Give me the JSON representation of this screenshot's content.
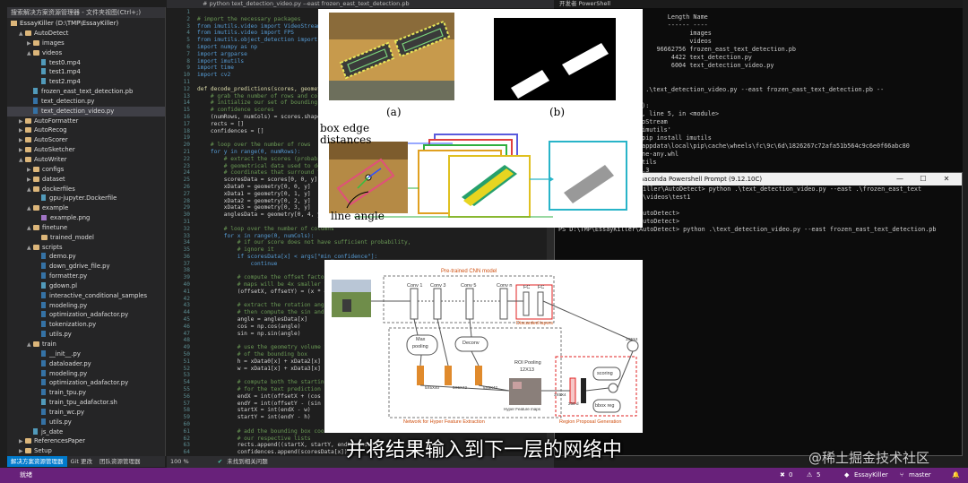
{
  "solution_explorer": {
    "search_placeholder": "搜索解决方案资源管理器 - 文件夹视图(Ctrl+;)",
    "root": "EssayKiller (D:\\TMP\\EssayKiller)",
    "items": [
      {
        "label": "AutoDetect",
        "kind": "folder",
        "arrow": "▲",
        "indent": 1
      },
      {
        "label": "images",
        "kind": "folder",
        "arrow": "▶",
        "indent": 2
      },
      {
        "label": "videos",
        "kind": "folder",
        "arrow": "▲",
        "indent": 2
      },
      {
        "label": "test0.mp4",
        "kind": "file",
        "arrow": "",
        "indent": 3
      },
      {
        "label": "test1.mp4",
        "kind": "file",
        "arrow": "",
        "indent": 3
      },
      {
        "label": "test2.mp4",
        "kind": "file",
        "arrow": "",
        "indent": 3
      },
      {
        "label": "frozen_east_text_detection.pb",
        "kind": "file",
        "arrow": "",
        "indent": 2
      },
      {
        "label": "text_detection.py",
        "kind": "py",
        "arrow": "",
        "indent": 2
      },
      {
        "label": "text_detection_video.py",
        "kind": "py",
        "arrow": "",
        "indent": 2,
        "selected": true
      },
      {
        "label": "AutoFormatter",
        "kind": "folder",
        "arrow": "▶",
        "indent": 1
      },
      {
        "label": "AutoRecog",
        "kind": "folder",
        "arrow": "▶",
        "indent": 1
      },
      {
        "label": "AutoScorer",
        "kind": "folder",
        "arrow": "▶",
        "indent": 1
      },
      {
        "label": "AutoSketcher",
        "kind": "folder",
        "arrow": "▶",
        "indent": 1
      },
      {
        "label": "AutoWriter",
        "kind": "folder",
        "arrow": "▲",
        "indent": 1
      },
      {
        "label": "configs",
        "kind": "folder",
        "arrow": "▶",
        "indent": 2
      },
      {
        "label": "dataset",
        "kind": "folder",
        "arrow": "▶",
        "indent": 2
      },
      {
        "label": "dockerfiles",
        "kind": "folder",
        "arrow": "▲",
        "indent": 2
      },
      {
        "label": "gpu-jupyter.Dockerfile",
        "kind": "file",
        "arrow": "",
        "indent": 3
      },
      {
        "label": "example",
        "kind": "folder",
        "arrow": "▲",
        "indent": 2
      },
      {
        "label": "example.png",
        "kind": "img",
        "arrow": "",
        "indent": 3
      },
      {
        "label": "finetune",
        "kind": "folder",
        "arrow": "▲",
        "indent": 2
      },
      {
        "label": "trained_model",
        "kind": "folder",
        "arrow": "",
        "indent": 3
      },
      {
        "label": "scripts",
        "kind": "folder",
        "arrow": "▲",
        "indent": 2
      },
      {
        "label": "demo.py",
        "kind": "py",
        "arrow": "",
        "indent": 3
      },
      {
        "label": "down_gdrive_file.py",
        "kind": "py",
        "arrow": "",
        "indent": 3
      },
      {
        "label": "formatter.py",
        "kind": "py",
        "arrow": "",
        "indent": 3
      },
      {
        "label": "gdown.pl",
        "kind": "file",
        "arrow": "",
        "indent": 3
      },
      {
        "label": "interactive_conditional_samples",
        "kind": "py",
        "arrow": "",
        "indent": 3
      },
      {
        "label": "modeling.py",
        "kind": "py",
        "arrow": "",
        "indent": 3
      },
      {
        "label": "optimization_adafactor.py",
        "kind": "py",
        "arrow": "",
        "indent": 3
      },
      {
        "label": "tokenization.py",
        "kind": "py",
        "arrow": "",
        "indent": 3
      },
      {
        "label": "utils.py",
        "kind": "py",
        "arrow": "",
        "indent": 3
      },
      {
        "label": "train",
        "kind": "folder",
        "arrow": "▲",
        "indent": 2
      },
      {
        "label": "__init__.py",
        "kind": "py",
        "arrow": "",
        "indent": 3
      },
      {
        "label": "dataloader.py",
        "kind": "py",
        "arrow": "",
        "indent": 3
      },
      {
        "label": "modeling.py",
        "kind": "py",
        "arrow": "",
        "indent": 3
      },
      {
        "label": "optimization_adafactor.py",
        "kind": "py",
        "arrow": "",
        "indent": 3
      },
      {
        "label": "train_tpu.py",
        "kind": "py",
        "arrow": "",
        "indent": 3
      },
      {
        "label": "train_tpu_adafactor.sh",
        "kind": "file",
        "arrow": "",
        "indent": 3
      },
      {
        "label": "train_wc.py",
        "kind": "py",
        "arrow": "",
        "indent": 3
      },
      {
        "label": "utils.py",
        "kind": "py",
        "arrow": "",
        "indent": 3
      },
      {
        "label": "js_date",
        "kind": "file",
        "arrow": "",
        "indent": 2
      },
      {
        "label": "ReferencesPaper",
        "kind": "folder",
        "arrow": "▶",
        "indent": 1
      },
      {
        "label": "Setup",
        "kind": "folder",
        "arrow": "▶",
        "indent": 1
      }
    ],
    "tabs": [
      {
        "label": "解决方案资源管理器",
        "active": true
      },
      {
        "label": "Git 更改",
        "active": false
      },
      {
        "label": "团队资源管理器",
        "active": false
      }
    ]
  },
  "editor": {
    "tab_title": "# python text_detection_video.py --east frozen_east_text_detection.pb",
    "zoom": "100 %",
    "issues": "未找到相关问题",
    "lines": [
      {
        "n": "",
        "t": "",
        "c": "code"
      },
      {
        "n": "",
        "t": "# import the necessary packages",
        "c": "comment"
      },
      {
        "n": "",
        "t": "from imutils.video import VideoStream",
        "c": "kw"
      },
      {
        "n": "",
        "t": "from imutils.video import FPS",
        "c": "kw"
      },
      {
        "n": "",
        "t": "from imutils.object_detection import non_max_suppression",
        "c": "kw"
      },
      {
        "n": "",
        "t": "import numpy as np",
        "c": "kw"
      },
      {
        "n": "",
        "t": "import argparse",
        "c": "kw"
      },
      {
        "n": "",
        "t": "import imutils",
        "c": "kw"
      },
      {
        "n": "",
        "t": "import time",
        "c": "kw"
      },
      {
        "n": "",
        "t": "import cv2",
        "c": "kw"
      },
      {
        "n": "",
        "t": "",
        "c": "code"
      },
      {
        "n": "",
        "t": "def decode_predictions(scores, geometry):",
        "c": "def"
      },
      {
        "n": "",
        "t": "    # grab the number of rows and columns",
        "c": "comment"
      },
      {
        "n": "",
        "t": "    # initialize our set of bounding box",
        "c": "comment"
      },
      {
        "n": "",
        "t": "    # confidence scores",
        "c": "comment"
      },
      {
        "n": "",
        "t": "    (numRows, numCols) = scores.shape[2:4]",
        "c": "code"
      },
      {
        "n": "",
        "t": "    rects = []",
        "c": "code"
      },
      {
        "n": "",
        "t": "    confidences = []",
        "c": "code"
      },
      {
        "n": "",
        "t": "",
        "c": "code"
      },
      {
        "n": "",
        "t": "    # loop over the number of rows",
        "c": "comment"
      },
      {
        "n": "",
        "t": "    for y in range(0, numRows):",
        "c": "kw"
      },
      {
        "n": "",
        "t": "        # extract the scores (probabilities)",
        "c": "comment"
      },
      {
        "n": "",
        "t": "        # geometrical data used to derive",
        "c": "comment"
      },
      {
        "n": "",
        "t": "        # coordinates that surround text",
        "c": "comment"
      },
      {
        "n": "",
        "t": "        scoresData = scores[0, 0, y]",
        "c": "code"
      },
      {
        "n": "",
        "t": "        xData0 = geometry[0, 0, y]",
        "c": "code"
      },
      {
        "n": "",
        "t": "        xData1 = geometry[0, 1, y]",
        "c": "code"
      },
      {
        "n": "",
        "t": "        xData2 = geometry[0, 2, y]",
        "c": "code"
      },
      {
        "n": "",
        "t": "        xData3 = geometry[0, 3, y]",
        "c": "code"
      },
      {
        "n": "",
        "t": "        anglesData = geometry[0, 4, y]",
        "c": "code"
      },
      {
        "n": "",
        "t": "",
        "c": "code"
      },
      {
        "n": "",
        "t": "        # loop over the number of columns",
        "c": "comment"
      },
      {
        "n": "",
        "t": "        for x in range(0, numCols):",
        "c": "kw"
      },
      {
        "n": "",
        "t": "            # if our score does not have sufficient probability,",
        "c": "comment"
      },
      {
        "n": "",
        "t": "            # ignore it",
        "c": "comment"
      },
      {
        "n": "",
        "t": "            if scoresData[x] < args[\"min_confidence\"]:",
        "c": "kw"
      },
      {
        "n": "",
        "t": "                continue",
        "c": "kw"
      },
      {
        "n": "",
        "t": "",
        "c": "code"
      },
      {
        "n": "",
        "t": "            # compute the offset factor as our",
        "c": "comment"
      },
      {
        "n": "",
        "t": "            # maps will be 4x smaller than the",
        "c": "comment"
      },
      {
        "n": "",
        "t": "            (offsetX, offsetY) = (x * 4.0, y * 4.0)",
        "c": "code"
      },
      {
        "n": "",
        "t": "",
        "c": "code"
      },
      {
        "n": "",
        "t": "            # extract the rotation angle for the",
        "c": "comment"
      },
      {
        "n": "",
        "t": "            # then compute the sin and cosine",
        "c": "comment"
      },
      {
        "n": "",
        "t": "            angle = anglesData[x]",
        "c": "code"
      },
      {
        "n": "",
        "t": "            cos = np.cos(angle)",
        "c": "code"
      },
      {
        "n": "",
        "t": "            sin = np.sin(angle)",
        "c": "code"
      },
      {
        "n": "",
        "t": "",
        "c": "code"
      },
      {
        "n": "",
        "t": "            # use the geometry volume to derive",
        "c": "comment"
      },
      {
        "n": "",
        "t": "            # of the bounding box",
        "c": "comment"
      },
      {
        "n": "",
        "t": "            h = xData0[x] + xData2[x]",
        "c": "code"
      },
      {
        "n": "",
        "t": "            w = xData1[x] + xData3[x]",
        "c": "code"
      },
      {
        "n": "",
        "t": "",
        "c": "code"
      },
      {
        "n": "",
        "t": "            # compute both the starting and ending",
        "c": "comment"
      },
      {
        "n": "",
        "t": "            # for the text prediction bounding box",
        "c": "comment"
      },
      {
        "n": "",
        "t": "            endX = int(offsetX + (cos * xData1[x]",
        "c": "code"
      },
      {
        "n": "",
        "t": "            endY = int(offsetY - (sin * xData1[x]",
        "c": "code"
      },
      {
        "n": "",
        "t": "            startX = int(endX - w)",
        "c": "code"
      },
      {
        "n": "",
        "t": "            startY = int(endY - h)",
        "c": "code"
      },
      {
        "n": "",
        "t": "",
        "c": "code"
      },
      {
        "n": "",
        "t": "            # add the bounding box coordinates",
        "c": "comment"
      },
      {
        "n": "",
        "t": "            # our respective lists",
        "c": "comment"
      },
      {
        "n": "",
        "t": "            rects.append((startX, startY, endX, endY))",
        "c": "code"
      },
      {
        "n": "",
        "t": "            confidences.append(scoresData[x])",
        "c": "code"
      }
    ]
  },
  "terminal_top": {
    "header": "开发者 PowerShell",
    "lines": [
      "        LastWriteTime         Length Name",
      "        -------------         ------ ----",
      "   11      15:10                    images",
      "   17      23:33                    videos",
      "   24      23:48           96662756 frozen_east_text_detection.pb",
      "   17       1:09               4422 text_detection.py",
      "    6       1:33               6004 text_detection_video.py",
      "",
      "",
      "ller\\AutoDetect> python .\\text_detection_video.py --east frozen_east_text_detection.pb --",
      "",
      " (most recent call last):",
      "ext_detection_video.py\", line 5, in <module>",
      "utils.video import VideoStream",
      "rror: No module named 'imutils'",
      "ssayKiller\\AutoDetect> pip install imutils",
      "C:\\Users\\Administrator\\appdata\\local\\pip\\cache\\wheels\\fc\\9c\\6d\\1826267c72afa51b564c9c6e0f66abc80",
      "\\2\\imutils-0.5.3-py3-none-any.whl",
      "collected packages: imutils",
      "y installed imutils-0.5.3",
      "ssayKiller\\AutoDetect> "
    ]
  },
  "terminal_prompt": {
    "title": "Anaconda Powershell Prompt (9.12.10C)",
    "lines": [
      "(base) PS D:\\TMP\\EssayKiller\\AutoDetect> python .\\text_detection_video.py --east .\\frozen_east_text",
      "_detection.pb --video .\\videos\\test1",
      "",
      "PS D:\\TMP\\EssayKiller\\AutoDetect> ",
      "PS D:\\TMP\\EssayKiller\\AutoDetect> ",
      "PS D:\\TMP\\EssayKiller\\AutoDetect> python .\\text_detection_video.py --east frozen_east_text_detection.pb"
    ]
  },
  "figure_top": {
    "label_a": "(a)",
    "label_b": "(b)",
    "box_edge": "box edge",
    "distances": "distances",
    "line_angle": "line angle"
  },
  "figure_bottom": {
    "title": "Pre-trained CNN model",
    "conv1": "Conv 1",
    "conv3": "Conv 3",
    "conv5": "Conv 5",
    "convn": "Conv n",
    "fc1": "FC",
    "fc2": "FC",
    "discarded": "Discarded layers",
    "max_pooling_1": "Max",
    "max_pooling_2": "pooling",
    "deconv": "Deconv",
    "roi_pooling": "ROI Pooling",
    "roi_size": "12X13",
    "k1": "5X5X40",
    "k2": "5X5X42",
    "k3": "5X5X42",
    "k4": "3X5X4",
    "k5": "256-d",
    "hyper_maps": "Hyper Feature maps",
    "scoring": "scoring",
    "bbox_reg": "bbox reg",
    "net_hyper": "Network for Hyper Feature Extraction",
    "region_gen": "Region Proposal Generation",
    "corner_label": "3X5X4"
  },
  "statusbar": {
    "ready": "就绪",
    "errors": "0",
    "warnings": "5",
    "project": "EssayKiller",
    "branch": "master"
  },
  "subtitle": "并将结果输入到下一层的网络中",
  "watermark": "@稀土掘金技术社区"
}
